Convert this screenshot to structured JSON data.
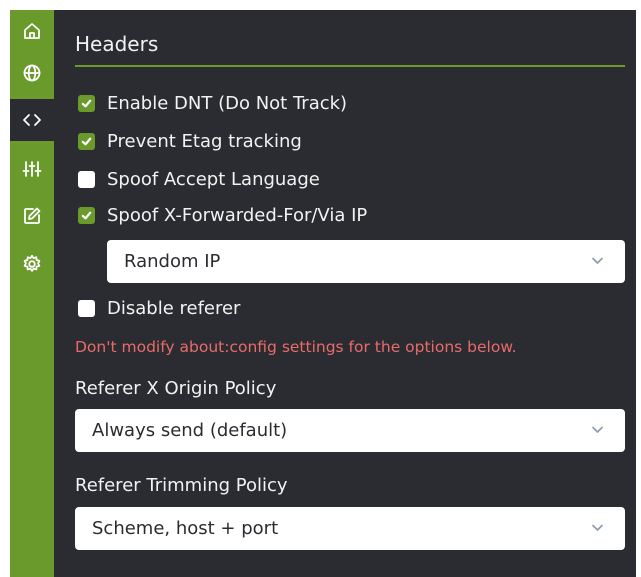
{
  "sidebar": {
    "items": [
      {
        "name": "home-icon",
        "active": false
      },
      {
        "name": "globe-icon",
        "active": false
      },
      {
        "name": "code-icon",
        "active": true
      },
      {
        "name": "sliders-icon",
        "active": false
      },
      {
        "name": "edit-icon",
        "active": false
      },
      {
        "name": "gear-icon",
        "active": false
      }
    ],
    "color": "#6b9a2c"
  },
  "section": {
    "title": "Headers"
  },
  "options": {
    "dnt": {
      "label": "Enable DNT (Do Not Track)",
      "checked": true
    },
    "etag": {
      "label": "Prevent Etag tracking",
      "checked": true
    },
    "accept_language": {
      "label": "Spoof Accept Language",
      "checked": false
    },
    "xff": {
      "label": "Spoof X-Forwarded-For/Via IP",
      "checked": true
    },
    "disable_referer": {
      "label": "Disable referer",
      "checked": false
    }
  },
  "ip_select": {
    "value": "Random IP"
  },
  "warning": "Don't modify about:config settings for the options below.",
  "referer_x_origin": {
    "label": "Referer X Origin Policy",
    "value": "Always send (default)"
  },
  "referer_trimming": {
    "label": "Referer Trimming Policy",
    "value": "Scheme, host + port"
  },
  "colors": {
    "accent": "#6b9a2c",
    "background": "#2b2c31",
    "warning": "#e86a6a"
  }
}
